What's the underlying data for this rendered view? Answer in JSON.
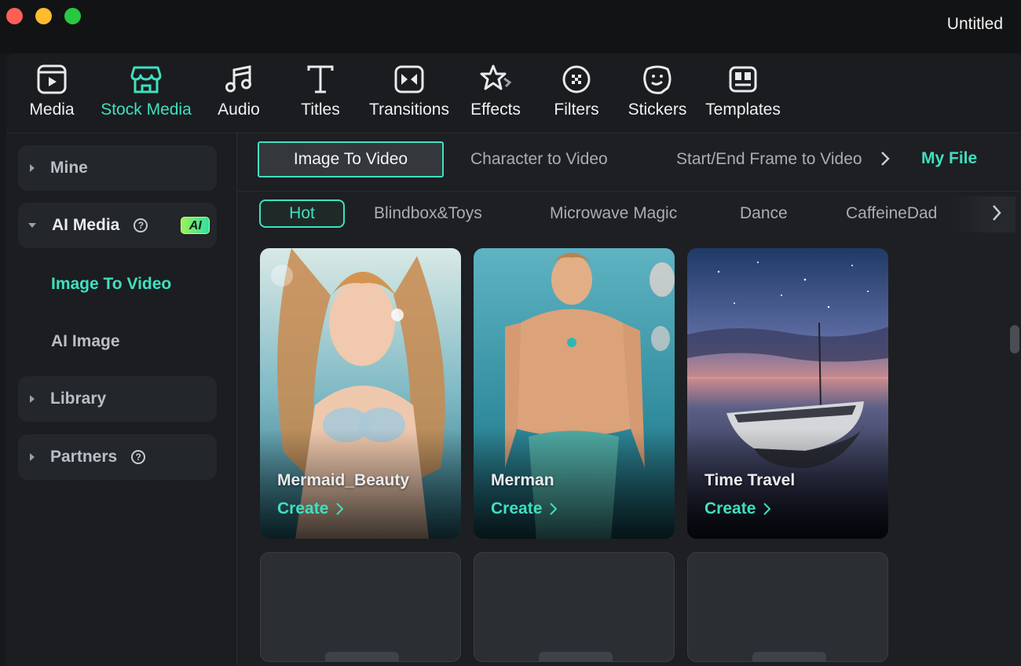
{
  "window": {
    "title": "Untitled"
  },
  "colors": {
    "accent": "#3fe0c0",
    "background": "#1d1f22",
    "sidebar_group": "#23262a"
  },
  "toolbar": {
    "items": [
      {
        "label": "Media",
        "icon": "media-icon"
      },
      {
        "label": "Stock Media",
        "icon": "store-icon",
        "active": true
      },
      {
        "label": "Audio",
        "icon": "music-note-icon"
      },
      {
        "label": "Titles",
        "icon": "text-t-icon"
      },
      {
        "label": "Transitions",
        "icon": "transition-icon"
      },
      {
        "label": "Effects",
        "icon": "effects-star-icon"
      },
      {
        "label": "Filters",
        "icon": "filter-icon"
      },
      {
        "label": "Stickers",
        "icon": "sticker-icon"
      },
      {
        "label": "Templates",
        "icon": "template-icon"
      }
    ]
  },
  "sidebar": {
    "mine": "Mine",
    "ai_media": "AI Media",
    "ai_badge": "AI",
    "sub_items": [
      "Image To Video",
      "AI Image"
    ],
    "library": "Library",
    "partners": "Partners"
  },
  "tabs": {
    "items": [
      "Image To Video",
      "Character to Video",
      "Start/End Frame to Video"
    ],
    "my_file": "My File"
  },
  "categories": [
    "Hot",
    "Blindbox&Toys",
    "Microwave Magic",
    "Dance",
    "CaffeineDad"
  ],
  "cards": [
    {
      "title": "Mermaid_Beauty",
      "cta": "Create"
    },
    {
      "title": "Merman",
      "cta": "Create"
    },
    {
      "title": "Time Travel",
      "cta": "Create"
    }
  ]
}
